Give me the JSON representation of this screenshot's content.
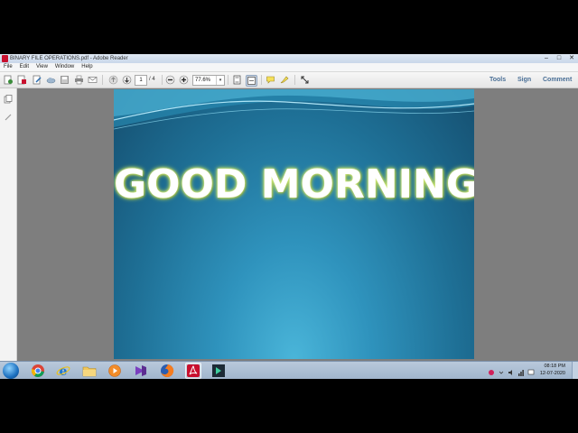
{
  "window": {
    "title": "BINARY FILE OPERATIONS.pdf - Adobe Reader",
    "controls": [
      "–",
      "□",
      "✕"
    ]
  },
  "menubar": {
    "items": [
      "File",
      "Edit",
      "View",
      "Window",
      "Help"
    ]
  },
  "toolbar": {
    "page_current": "1",
    "page_total": "/ 4",
    "zoom": "77.6%",
    "zoom_caret": "▾",
    "tools_label": "Tools",
    "sign_label": "Sign",
    "comment_label": "Comment"
  },
  "document": {
    "slide_title": "GOOD MORNING"
  },
  "taskbar": {
    "apps": [
      "chrome-icon",
      "ie-icon",
      "explorer-icon",
      "media-player-icon",
      "visual-studio-icon",
      "firefox-icon",
      "adobe-reader-icon",
      "app-icon"
    ],
    "active_app": "adobe-reader-icon",
    "clock_time": "08:18 PM",
    "clock_date": "12-07-2020"
  },
  "colors": {
    "slide_dark": "#154f70",
    "slide_light": "#4ab5d9",
    "title_glow": "#c9e46a",
    "link": "#4a6f96"
  }
}
